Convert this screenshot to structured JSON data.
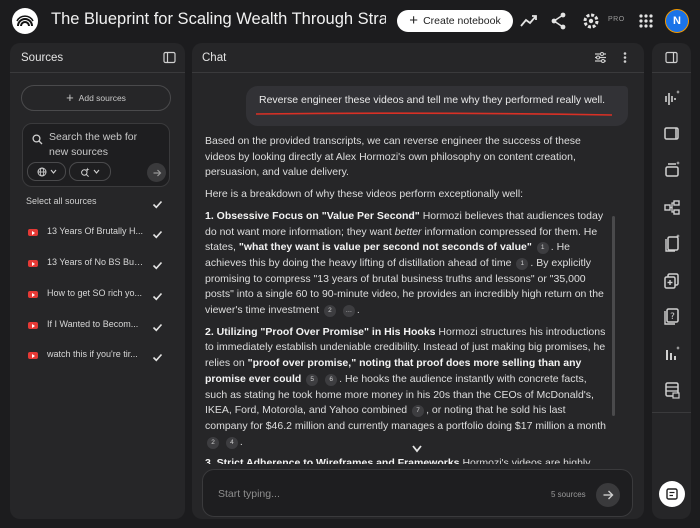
{
  "header": {
    "title": "The Blueprint for Scaling Wealth Through Strategic",
    "create_label": "Create notebook",
    "pro_badge": "PRO",
    "avatar_initial": "N"
  },
  "sources_panel": {
    "title": "Sources",
    "add_label": "Add sources",
    "search_text": "Search the web for new sources",
    "select_all": "Select all sources",
    "items": [
      {
        "label": "13 Years Of Brutally H..."
      },
      {
        "label": "13 Years of No BS Bus..."
      },
      {
        "label": "How to get SO rich yo..."
      },
      {
        "label": "If I Wanted to Becom..."
      },
      {
        "label": "watch this if you're tir..."
      }
    ]
  },
  "chat": {
    "title": "Chat",
    "user_message": "Reverse engineer these videos and tell me why they performed really well.",
    "input_placeholder": "Start typing...",
    "source_count": "5 sources"
  },
  "colors": {
    "accent_underline": "#d93025",
    "avatar_bg": "#1a73e8"
  }
}
